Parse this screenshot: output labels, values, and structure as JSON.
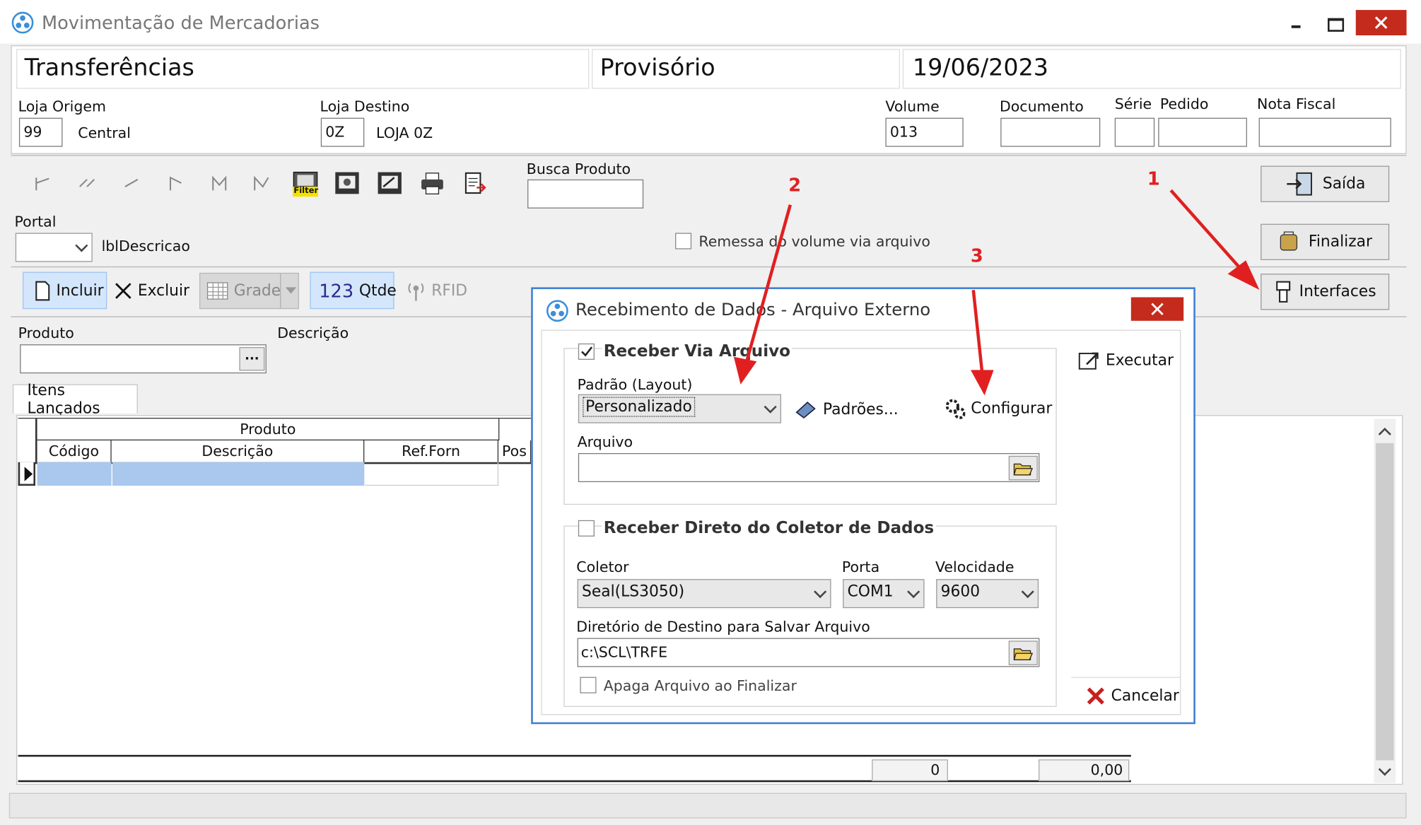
{
  "window": {
    "title": "Movimentação de Mercadorias"
  },
  "header": {
    "tipo": "Transferências",
    "status": "Provisório",
    "data": "19/06/2023"
  },
  "fields": {
    "loja_origem_label": "Loja Origem",
    "loja_origem_code": "99",
    "loja_origem_name": "Central",
    "loja_destino_label": "Loja Destino",
    "loja_destino_code": "0Z",
    "loja_destino_name": "LOJA 0Z",
    "volume_label": "Volume",
    "volume_value": "013",
    "documento_label": "Documento",
    "serie_label": "Série",
    "pedido_label": "Pedido",
    "nota_fiscal_label": "Nota Fiscal"
  },
  "toolbar": {
    "busca_label": "Busca Produto",
    "filter_tag": "Filter"
  },
  "portal": {
    "label": "Portal",
    "descricao": "lblDescricao",
    "remessa_label": "Remessa do volume via arquivo"
  },
  "buttons": {
    "saida": "Saída",
    "finalizar": "Finalizar",
    "interfaces": "Interfaces"
  },
  "actions": {
    "incluir": "Incluir",
    "excluir": "Excluir",
    "grade": "Grade",
    "qtde_num": "123",
    "qtde": "Qtde",
    "rfid": "RFID"
  },
  "produto": {
    "label": "Produto",
    "descricao_label": "Descrição",
    "ellipsis": "···"
  },
  "tab": {
    "label": "Itens Lançados"
  },
  "grid": {
    "group_header": "Produto",
    "columns": [
      "Código",
      "Descrição",
      "Ref.Forn",
      "Pos"
    ],
    "total_qty": "0",
    "total_value": "0,00"
  },
  "dialog": {
    "title": "Recebimento de Dados - Arquivo Externo",
    "receber_arquivo": "Receber Via Arquivo",
    "padrao_label": "Padrão (Layout)",
    "padrao_value": "Personalizado",
    "padroes_btn": "Padrões...",
    "configurar_btn": "Configurar",
    "arquivo_label": "Arquivo",
    "receber_coletor": "Receber Direto do Coletor de Dados",
    "coletor_label": "Coletor",
    "coletor_value": "Seal(LS3050)",
    "porta_label": "Porta",
    "porta_value": "COM1",
    "velocidade_label": "Velocidade",
    "velocidade_value": "9600",
    "diretorio_label": "Diretório de Destino para Salvar Arquivo",
    "diretorio_value": "c:\\SCL\\TRFE",
    "apaga_label": "Apaga Arquivo ao Finalizar",
    "executar": "Executar",
    "cancelar": "Cancelar"
  },
  "annotations": [
    "1",
    "2",
    "3"
  ],
  "colors": {
    "accent_red": "#c42b1c",
    "selection_blue": "#aac8ee",
    "annotation_red": "#e02020",
    "dialog_border": "#3b7fd4"
  }
}
